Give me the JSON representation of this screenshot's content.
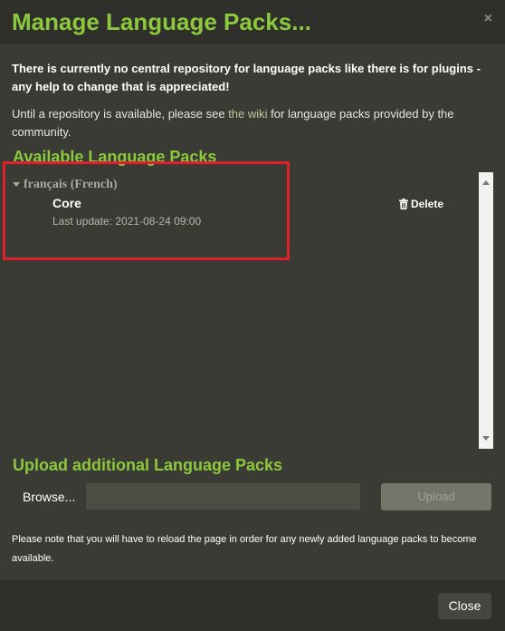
{
  "dialog": {
    "title": "Manage Language Packs...",
    "close_symbol": "×"
  },
  "intro": {
    "bold": "There is currently no central repository for language packs like there is for plugins - any help to change that is appreciated!",
    "text_before": "Until a repository is available, please see ",
    "link": "the wiki",
    "text_after": " for language packs provided by the community."
  },
  "available": {
    "title": "Available Language Packs",
    "languages": [
      {
        "name": "français (French)",
        "packs": [
          {
            "name": "Core",
            "last_update": "Last update: 2021-08-24 09:00",
            "delete_label": "Delete"
          }
        ]
      }
    ]
  },
  "upload": {
    "title": "Upload additional Language Packs",
    "browse_label": "Browse...",
    "upload_label": "Upload"
  },
  "note": "Please note that you will have to reload the page in order for any newly added language packs to become available.",
  "footer": {
    "close_label": "Close"
  }
}
